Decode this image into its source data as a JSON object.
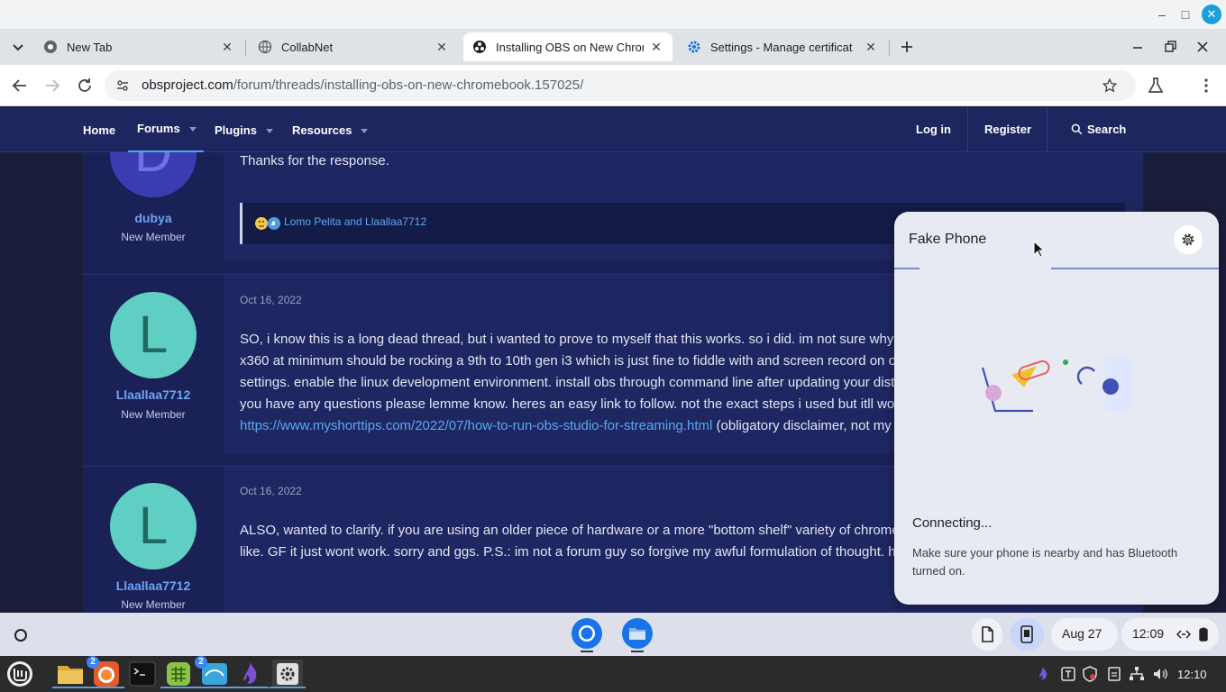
{
  "browser": {
    "tabs": [
      {
        "title": "New Tab",
        "active": false
      },
      {
        "title": "CollabNet",
        "active": false
      },
      {
        "title": "Installing OBS on New Chrom",
        "active": true
      },
      {
        "title": "Settings - Manage certificat",
        "active": false
      }
    ],
    "url_host": "obsproject.com",
    "url_path": "/forum/threads/installing-obs-on-new-chromebook.157025/"
  },
  "forum_nav": {
    "home": "Home",
    "forums": "Forums",
    "plugins": "Plugins",
    "resources": "Resources",
    "login": "Log in",
    "register": "Register",
    "search": "Search"
  },
  "posts": [
    {
      "avatar_letter": "D",
      "username": "dubya",
      "role": "New Member",
      "text": "Thanks for the response.",
      "reactions": "Lomo Pelita and Llaallaa7712"
    },
    {
      "avatar_letter": "L",
      "username": "Llaallaa7712",
      "role": "New Member",
      "date": "Oct 16, 2022",
      "lines": [
        "SO, i know this is a long dead thread, but i wanted to prove to myself that this works. so i did. im not sure why",
        "x360 at minimum should be rocking a 9th to 10th gen i3 which is just fine to fiddle with and screen record on o",
        "settings. enable the linux development environment. install obs through command line after updating your dist",
        "you have any questions please lemme know. heres an easy link to follow. not the exact steps i used but itll wo"
      ],
      "link": "https://www.myshorttips.com/2022/07/how-to-run-obs-studio-for-streaming.html",
      "link_after": " (obligatory disclaimer, not my"
    },
    {
      "avatar_letter": "L",
      "username": "Llaallaa7712",
      "role": "New Member",
      "date": "Oct 16, 2022",
      "lines": [
        "ALSO, wanted to clarify. if you are using an older piece of hardware or a more \"bottom shelf\" variety of chrome",
        "like. GF it just wont work. sorry and ggs. P.S.: im not a forum guy so forgive my awful formulation of thought. h"
      ]
    }
  ],
  "phone_hub": {
    "title": "Fake Phone",
    "status": "Connecting...",
    "help": "Make sure your phone is nearby and has Bluetooth turned on."
  },
  "shelf": {
    "date": "Aug 27",
    "time": "12:09"
  },
  "taskbar": {
    "clock": "12:10",
    "badges": {
      "firefox": "2",
      "store": "2"
    }
  },
  "colors": {
    "forum_nav_bg": "#1e2660",
    "link": "#5aa8f0",
    "username": "#6ea4f1",
    "avatar_d": "#3a3db0",
    "avatar_l": "#5ecfc2"
  }
}
